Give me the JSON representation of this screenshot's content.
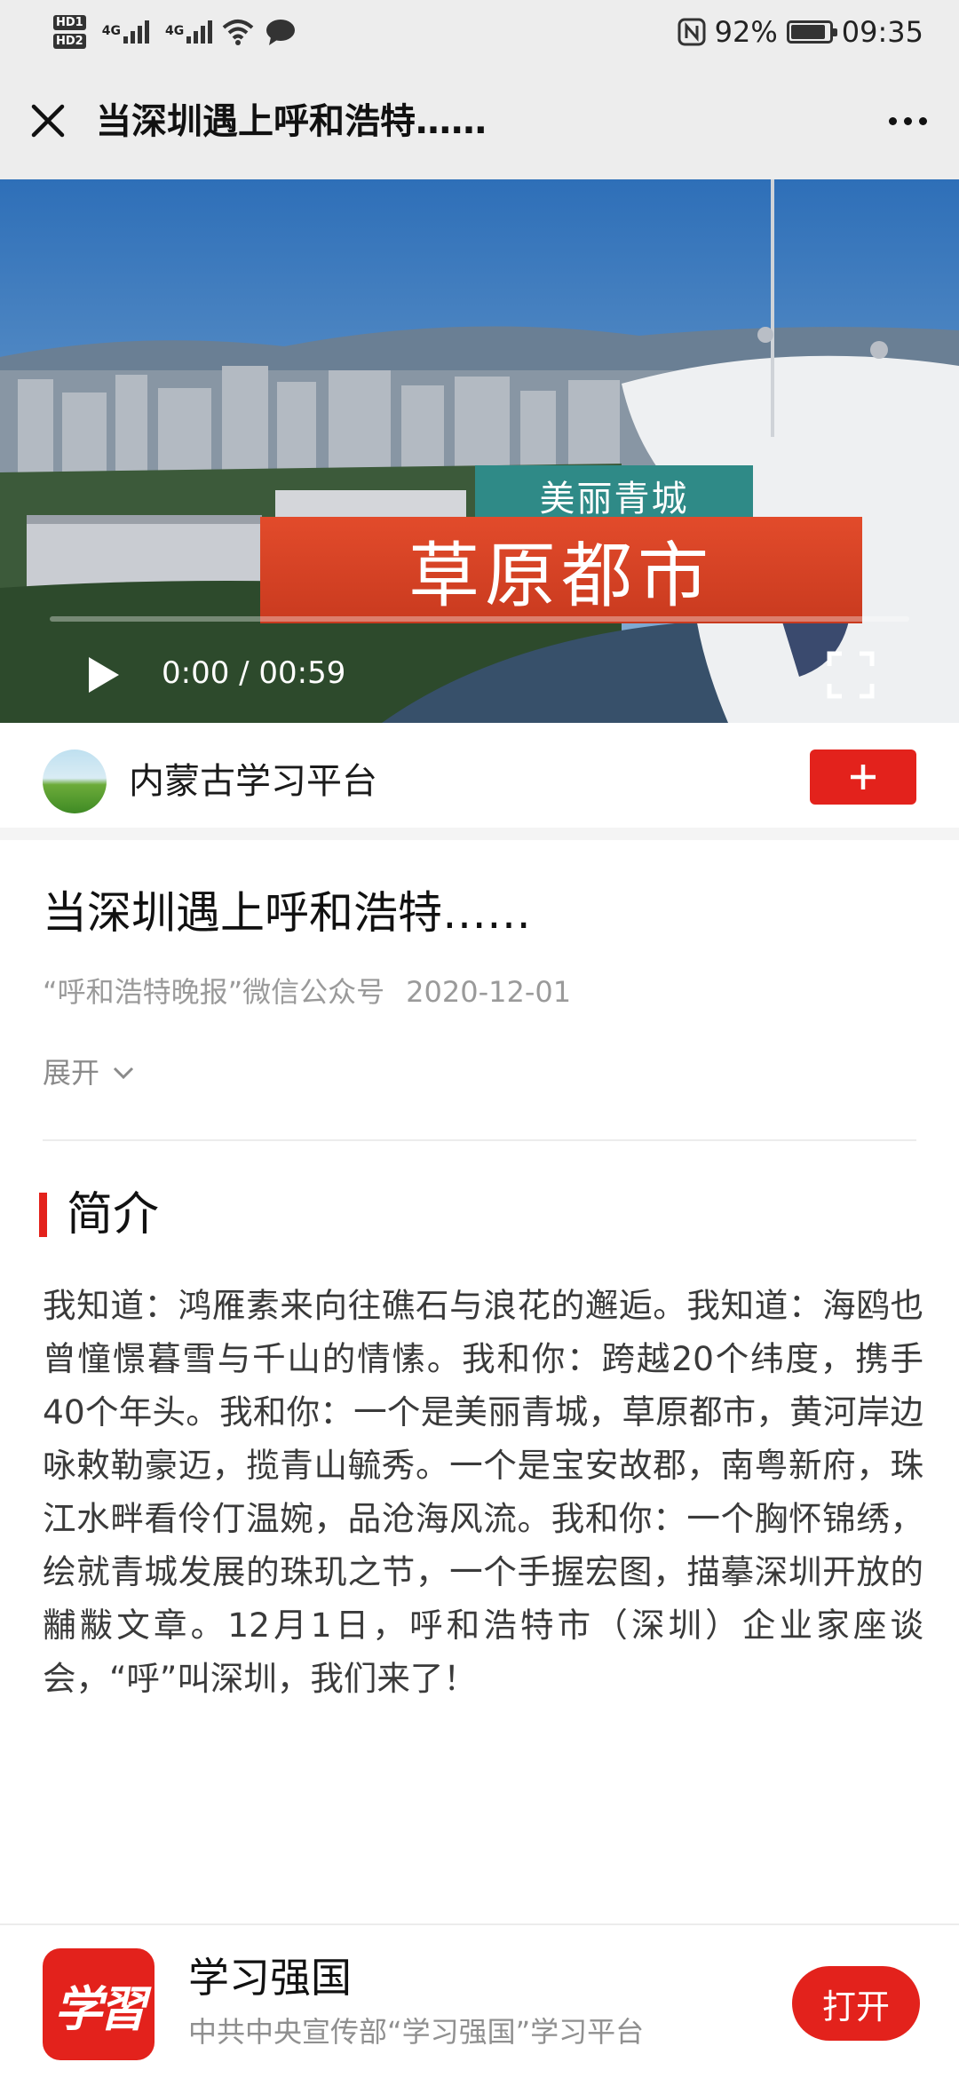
{
  "status_bar": {
    "hd1": "HD1",
    "hd2": "HD2",
    "net1": "4G",
    "net2": "4G",
    "battery_percent": "92%",
    "battery_level": 0.92,
    "time": "09:35",
    "icons": [
      "hd-icon",
      "signal-icon",
      "wifi-icon",
      "chat-icon",
      "nfc-icon",
      "battery-icon"
    ]
  },
  "header": {
    "title": "当深圳遇上呼和浩特……",
    "close_icon": "close-icon",
    "more_icon": "more-icon"
  },
  "video": {
    "banner_small": "美丽青城",
    "banner_large": "草原都市",
    "time_display": "0:00 / 00:59",
    "progress": 0.0,
    "controls": [
      "play-icon",
      "fullscreen-icon"
    ]
  },
  "publisher": {
    "name": "内蒙古学习平台",
    "follow_icon": "plus-icon"
  },
  "article": {
    "title": "当深圳遇上呼和浩特……",
    "source": "“呼和浩特晚报”微信公众号",
    "date": "2020-12-01",
    "expand_label": "展开",
    "section_title": "简介",
    "intro": "我知道：鸿雁素来向往礁石与浪花的邂逅。我知道：海鸥也曾憧憬暮雪与千山的情愫。我和你：跨越20个纬度，携手40个年头。我和你：一个是美丽青城，草原都市，黄河岸边咏敕勒豪迈，揽青山毓秀。一个是宝安故郡，南粤新府，珠江水畔看伶仃温婉，品沧海风流。我和你：一个胸怀锦绣，绘就青城发展的珠玑之节，一个手握宏图，描摹深圳开放的黼黻文章。12月1日，呼和浩特市（深圳）企业家座谈会，“呼”叫深圳，我们来了！"
  },
  "app_bar": {
    "logo_text": "学習",
    "name": "学习强国",
    "description": "中共中央宣传部“学习强国”学习平台",
    "open_label": "打开"
  },
  "colors": {
    "accent_red": "#e3221c",
    "bar_gray": "#ededed",
    "banner_teal": "#2f8a87"
  }
}
